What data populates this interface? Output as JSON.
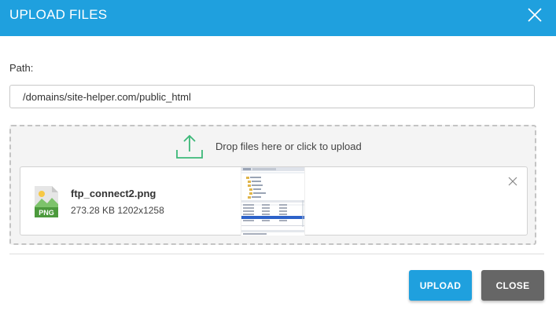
{
  "dialog": {
    "title": "UPLOAD FILES",
    "close_icon": "close-icon",
    "accent_color": "#1fa0de"
  },
  "path": {
    "label": "Path:",
    "value": "/domains/site-helper.com/public_html"
  },
  "dropzone": {
    "icon": "upload-icon",
    "text": "Drop files here or click to upload"
  },
  "file": {
    "icon": "png-file-icon",
    "icon_label": "PNG",
    "name": "ftp_connect2.png",
    "size": "273.28 KB",
    "dimensions": "1202x1258",
    "meta": "273.28 KB 1202x1258",
    "remove_icon": "remove-icon"
  },
  "buttons": {
    "upload_label": "UPLOAD",
    "close_label": "CLOSE"
  }
}
